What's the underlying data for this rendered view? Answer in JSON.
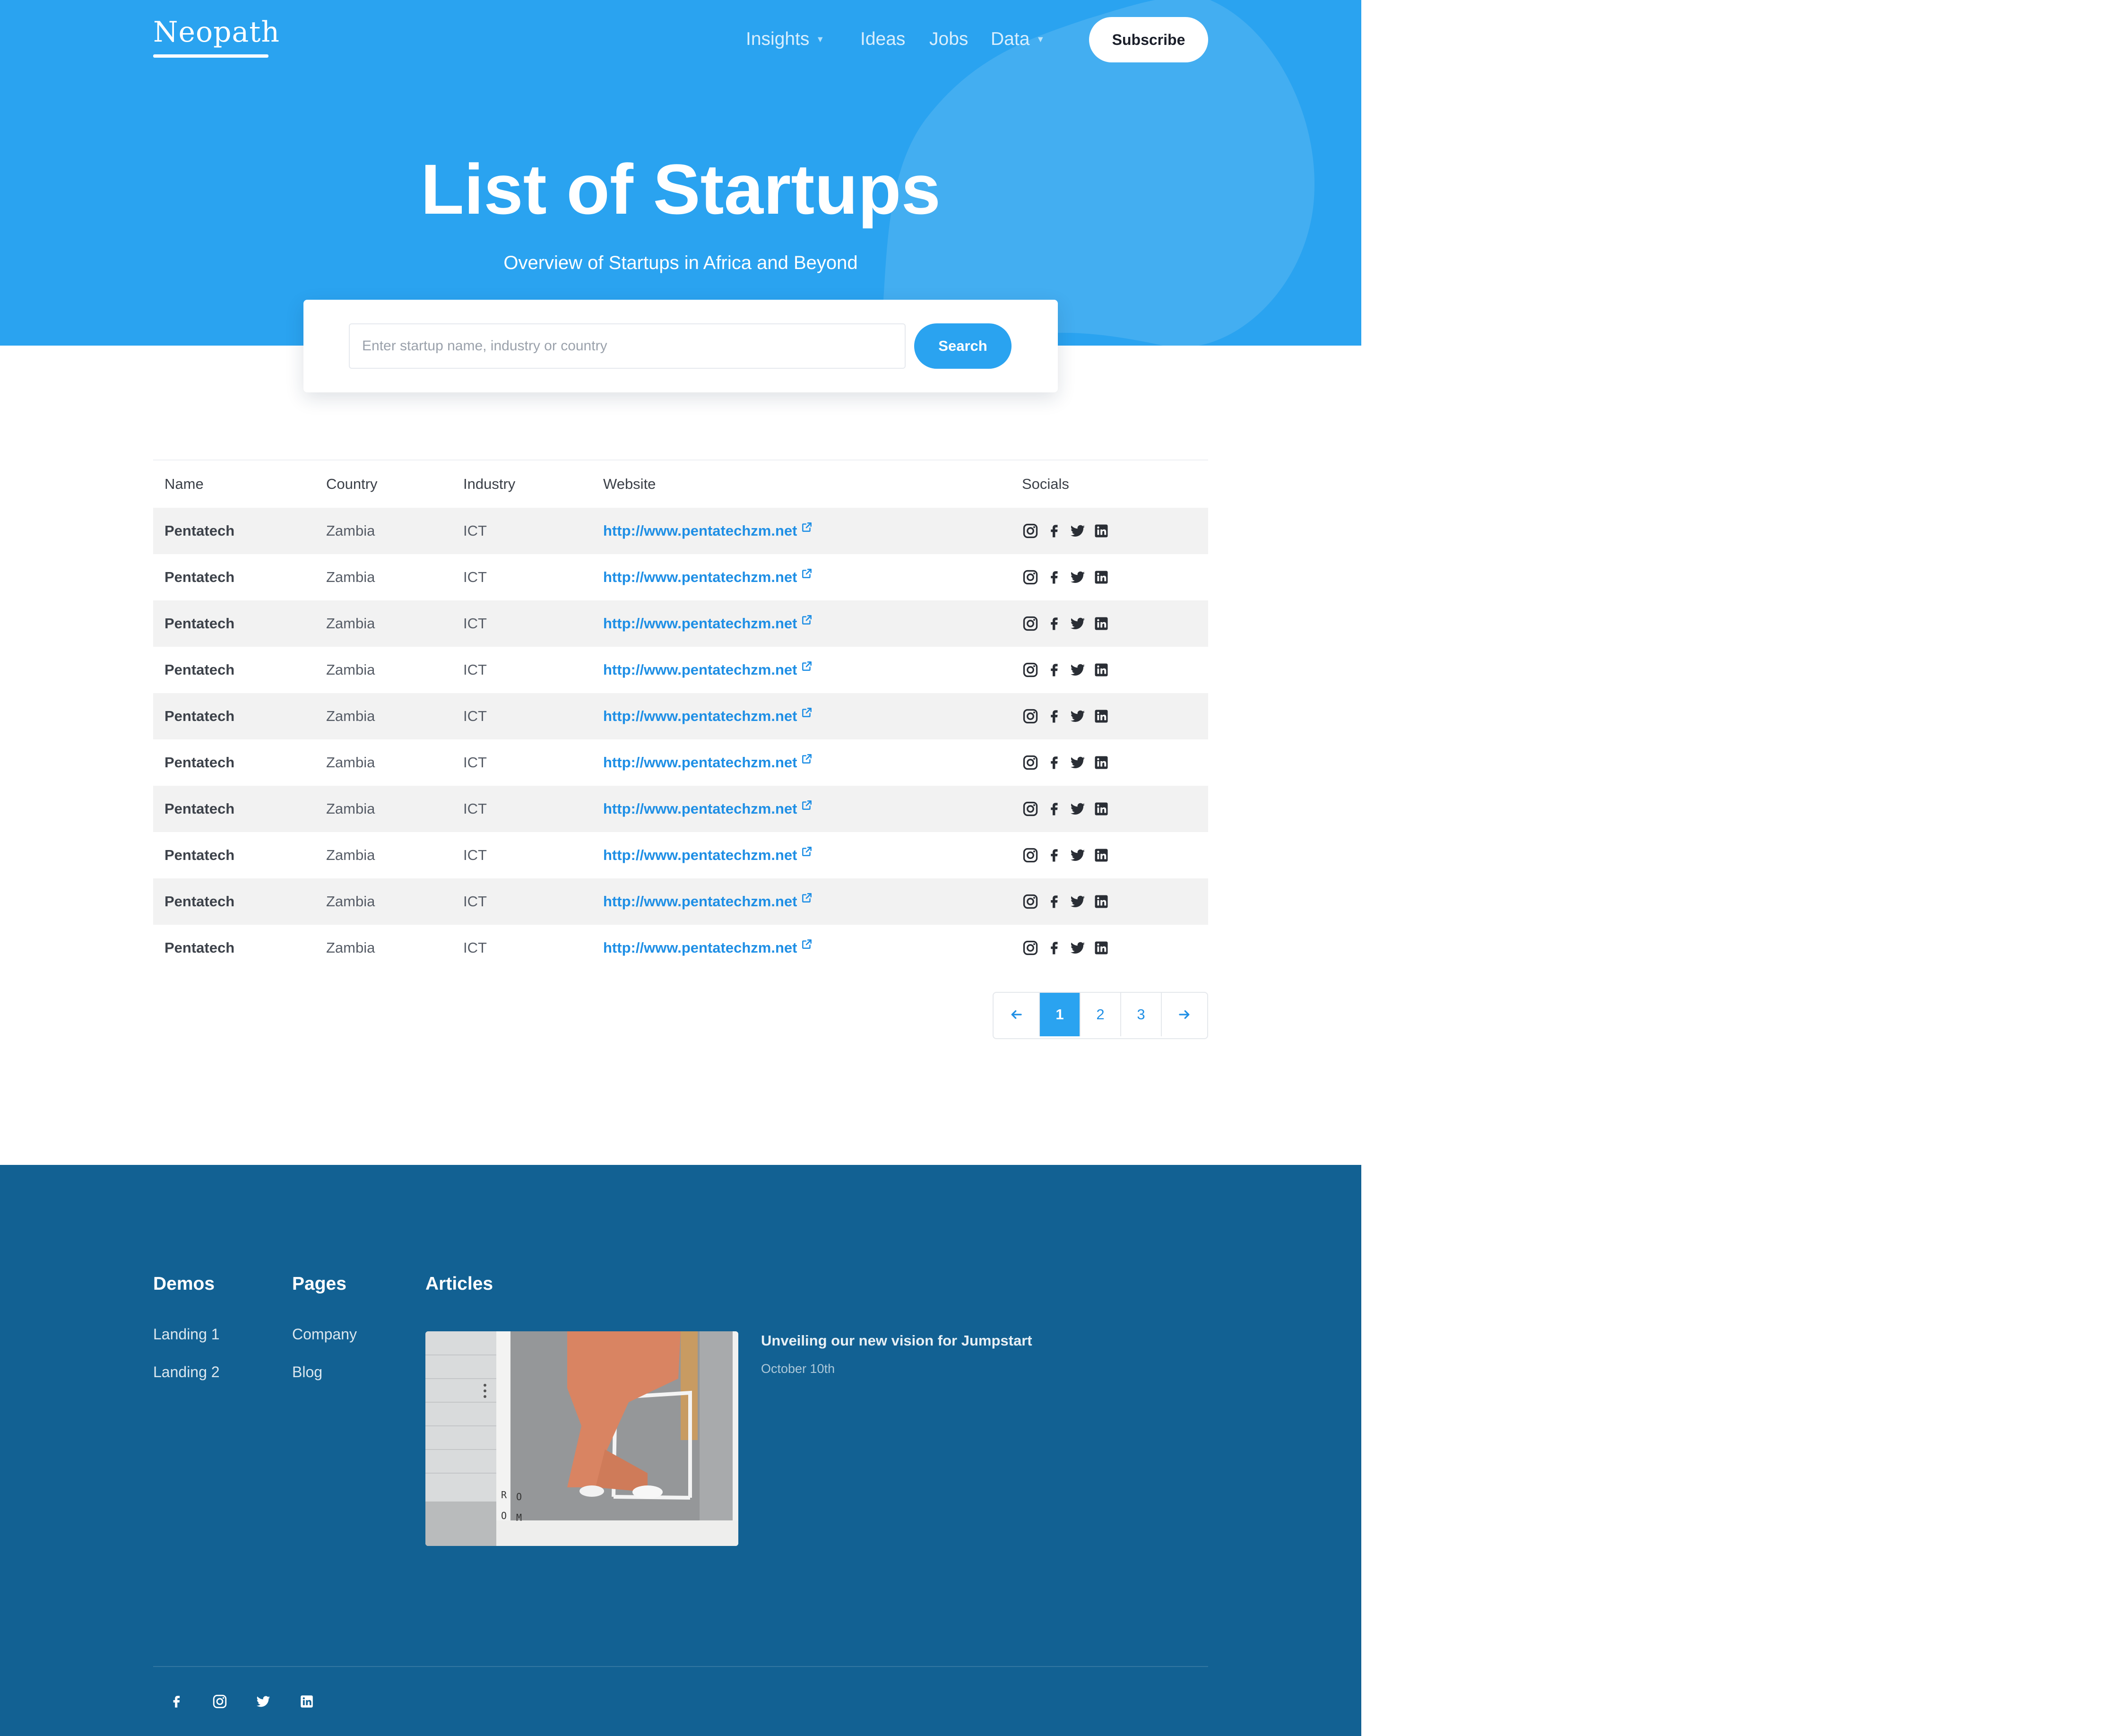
{
  "brand": "Neopath",
  "nav": {
    "items": [
      {
        "label": "Insights",
        "dropdown": true
      },
      {
        "label": "Ideas",
        "dropdown": false
      },
      {
        "label": "Jobs",
        "dropdown": false
      },
      {
        "label": "Data",
        "dropdown": true
      }
    ],
    "subscribe_label": "Subscribe"
  },
  "hero": {
    "title": "List of Startups",
    "subtitle": "Overview of Startups in Africa and Beyond"
  },
  "search": {
    "placeholder": "Enter startup name, industry or country",
    "button_label": "Search"
  },
  "table": {
    "columns": [
      "Name",
      "Country",
      "Industry",
      "Website",
      "Socials"
    ],
    "rows": [
      {
        "name": "Pentatech",
        "country": "Zambia",
        "industry": "ICT",
        "website": "http://www.pentatechzm.net",
        "socials": [
          "instagram-icon",
          "facebook-icon",
          "twitter-icon",
          "linkedin-icon"
        ]
      },
      {
        "name": "Pentatech",
        "country": "Zambia",
        "industry": "ICT",
        "website": "http://www.pentatechzm.net",
        "socials": [
          "instagram-icon",
          "facebook-icon",
          "twitter-icon",
          "linkedin-icon"
        ]
      },
      {
        "name": "Pentatech",
        "country": "Zambia",
        "industry": "ICT",
        "website": "http://www.pentatechzm.net",
        "socials": [
          "instagram-icon",
          "facebook-icon",
          "twitter-icon",
          "linkedin-icon"
        ]
      },
      {
        "name": "Pentatech",
        "country": "Zambia",
        "industry": "ICT",
        "website": "http://www.pentatechzm.net",
        "socials": [
          "instagram-icon",
          "facebook-icon",
          "twitter-icon",
          "linkedin-icon"
        ]
      },
      {
        "name": "Pentatech",
        "country": "Zambia",
        "industry": "ICT",
        "website": "http://www.pentatechzm.net",
        "socials": [
          "instagram-icon",
          "facebook-icon",
          "twitter-icon",
          "linkedin-icon"
        ]
      },
      {
        "name": "Pentatech",
        "country": "Zambia",
        "industry": "ICT",
        "website": "http://www.pentatechzm.net",
        "socials": [
          "instagram-icon",
          "facebook-icon",
          "twitter-icon",
          "linkedin-icon"
        ]
      },
      {
        "name": "Pentatech",
        "country": "Zambia",
        "industry": "ICT",
        "website": "http://www.pentatechzm.net",
        "socials": [
          "instagram-icon",
          "facebook-icon",
          "twitter-icon",
          "linkedin-icon"
        ]
      },
      {
        "name": "Pentatech",
        "country": "Zambia",
        "industry": "ICT",
        "website": "http://www.pentatechzm.net",
        "socials": [
          "instagram-icon",
          "facebook-icon",
          "twitter-icon",
          "linkedin-icon"
        ]
      },
      {
        "name": "Pentatech",
        "country": "Zambia",
        "industry": "ICT",
        "website": "http://www.pentatechzm.net",
        "socials": [
          "instagram-icon",
          "facebook-icon",
          "twitter-icon",
          "linkedin-icon"
        ]
      },
      {
        "name": "Pentatech",
        "country": "Zambia",
        "industry": "ICT",
        "website": "http://www.pentatechzm.net",
        "socials": [
          "instagram-icon",
          "facebook-icon",
          "twitter-icon",
          "linkedin-icon"
        ]
      }
    ]
  },
  "pagination": {
    "prev_icon": "arrow-left-icon",
    "pages": [
      "1",
      "2",
      "3"
    ],
    "current": "1",
    "next_icon": "arrow-right-icon"
  },
  "footer": {
    "columns": [
      {
        "heading": "Demos",
        "links": [
          "Landing 1",
          "Landing 2"
        ]
      },
      {
        "heading": "Pages",
        "links": [
          "Company",
          "Blog"
        ]
      }
    ],
    "articles_heading": "Articles",
    "article": {
      "title": "Unveiling our new vision for Jumpstart",
      "date": "October 10th",
      "image_text": [
        "R",
        "O",
        "O",
        "M"
      ]
    },
    "socials": [
      "facebook-icon",
      "instagram-icon",
      "twitter-icon",
      "linkedin-icon"
    ]
  },
  "colors": {
    "hero_blue": "#2aa3f0",
    "footer_blue": "#126193",
    "link_blue": "#1f8fe5",
    "row_stripe": "#f2f2f2"
  }
}
